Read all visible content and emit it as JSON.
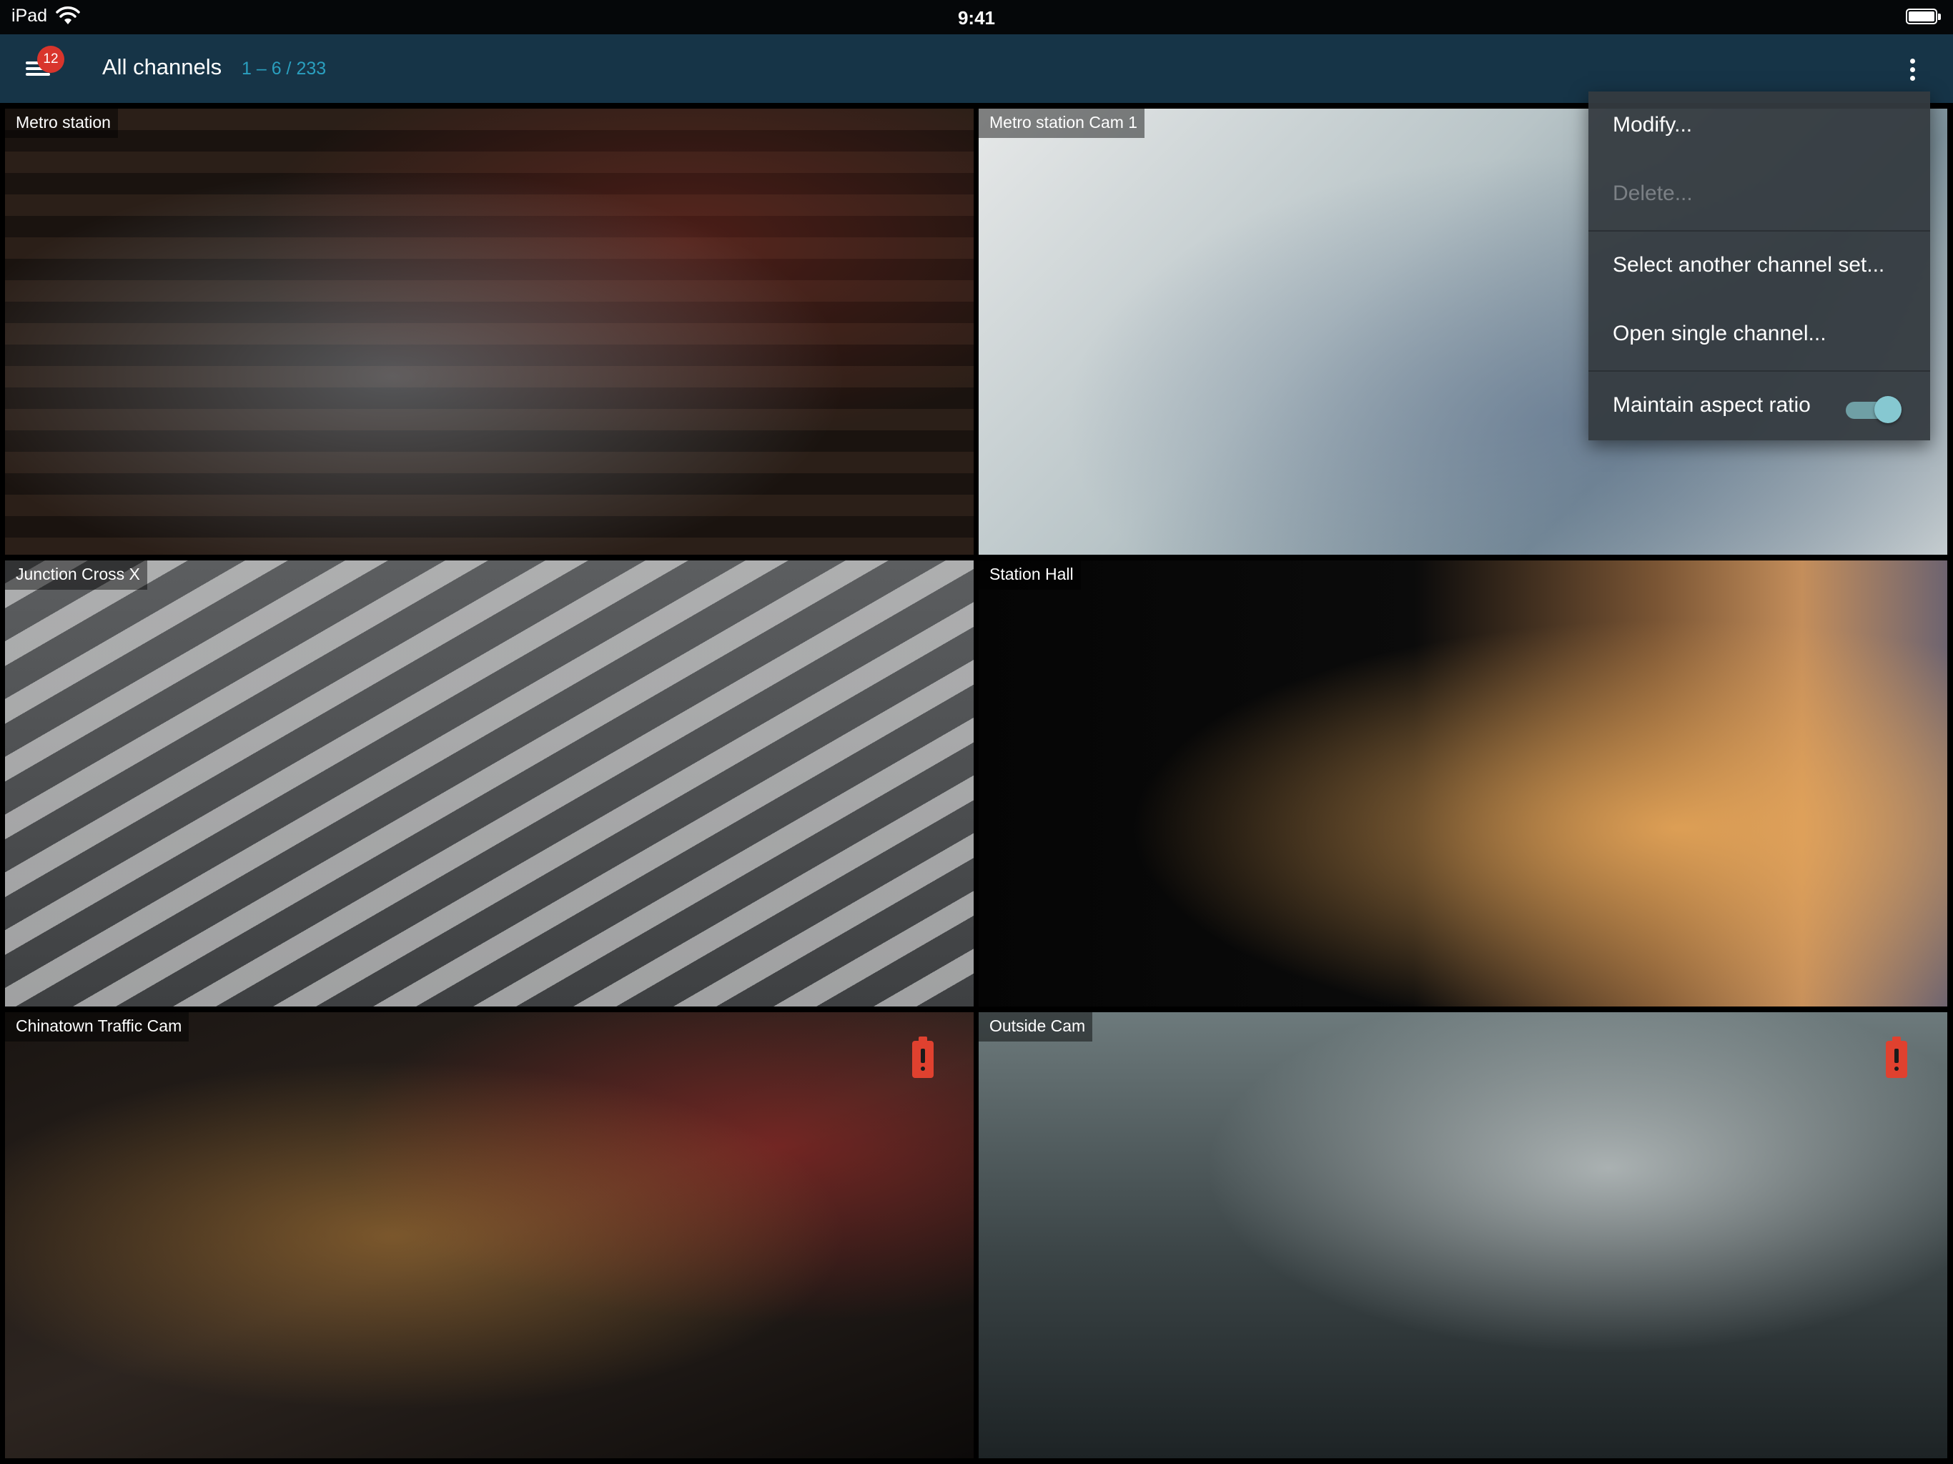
{
  "status_bar": {
    "device": "iPad",
    "time": "9:41"
  },
  "app_bar": {
    "notification_count": "12",
    "title": "All channels",
    "page_range": "1 – 6 / 233"
  },
  "channels": [
    {
      "label": "Metro station",
      "alert": false
    },
    {
      "label": "Metro station Cam 1",
      "alert": false
    },
    {
      "label": "Junction Cross X",
      "alert": false
    },
    {
      "label": "Station Hall",
      "alert": false
    },
    {
      "label": "Chinatown Traffic Cam",
      "alert": true
    },
    {
      "label": "Outside Cam",
      "alert": true
    }
  ],
  "menu": {
    "items": [
      {
        "label": "Modify...",
        "enabled": true
      },
      {
        "label": "Delete...",
        "enabled": false
      },
      {
        "label": "Select another channel set...",
        "enabled": true
      },
      {
        "label": "Open single channel...",
        "enabled": true
      }
    ],
    "aspect_toggle": {
      "label": "Maintain aspect ratio",
      "on": true
    }
  },
  "colors": {
    "app_bar": "#163447",
    "accent": "#2a9fbf",
    "badge": "#d9352c",
    "alert": "#e0412f",
    "menu_bg": "#343a40",
    "toggle_on": "#86c8d1"
  },
  "icons": [
    "wifi-icon",
    "battery-icon",
    "hamburger-menu-icon",
    "overflow-menu-icon",
    "alert-icon"
  ]
}
